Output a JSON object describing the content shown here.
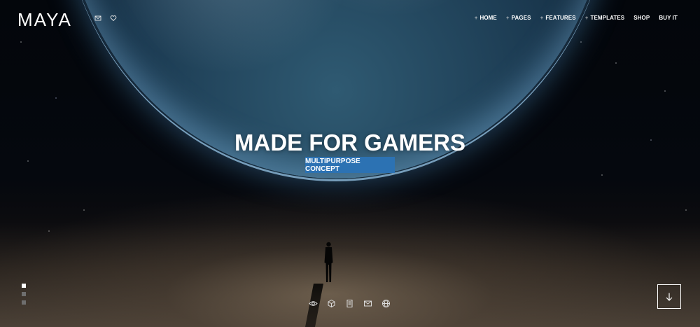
{
  "brand": {
    "logo_text": "MAYA"
  },
  "header_icons": [
    "mail-icon",
    "heart-icon"
  ],
  "nav": {
    "items": [
      {
        "label": "HOME",
        "has_plus": true
      },
      {
        "label": "PAGES",
        "has_plus": true
      },
      {
        "label": "FEATURES",
        "has_plus": true
      },
      {
        "label": "TEMPLATES",
        "has_plus": true
      },
      {
        "label": "SHOP",
        "has_plus": false
      },
      {
        "label": "BUY IT",
        "has_plus": false
      }
    ],
    "plus_symbol": "+"
  },
  "hero": {
    "headline": "MADE FOR GAMERS",
    "badge": "MULTIPURPOSE CONCEPT",
    "badge_color": "#2c72b3"
  },
  "slider": {
    "total_slides": 3,
    "active_index": 0
  },
  "bottom_icons": [
    "eye-icon",
    "cube-icon",
    "document-icon",
    "mail-icon",
    "globe-icon"
  ],
  "scroll_button": {
    "icon": "arrow-down-icon"
  }
}
